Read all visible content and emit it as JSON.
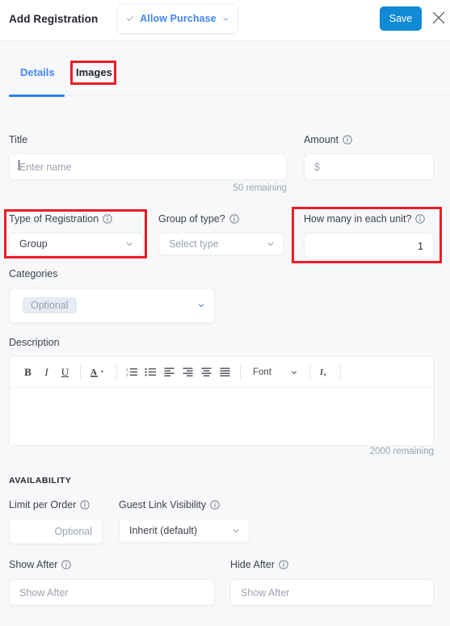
{
  "header": {
    "title": "Add Registration",
    "allow_purchase_label": "Allow Purchase",
    "save_label": "Save"
  },
  "tabs": [
    {
      "label": "Details",
      "active": true
    },
    {
      "label": "Images",
      "active": false
    }
  ],
  "form": {
    "title": {
      "label": "Title",
      "value": "",
      "placeholder": "Enter name",
      "counter": "50 remaining"
    },
    "amount": {
      "label": "Amount",
      "value": "",
      "placeholder": "$"
    },
    "type_of_registration": {
      "label": "Type of Registration",
      "value": "Group"
    },
    "group_of_type": {
      "label": "Group of type?",
      "value": "Select type"
    },
    "how_many_in_each_unit": {
      "label": "How many in each unit?",
      "value": "1"
    },
    "categories": {
      "label": "Categories",
      "chip": "Optional"
    },
    "description": {
      "label": "Description",
      "value": "",
      "counter": "2000 remaining",
      "toolbar": {
        "bold": "B",
        "italic": "I",
        "underline": "U",
        "text_color": "A",
        "font_label": "Font"
      }
    }
  },
  "availability": {
    "heading": "AVAILABILITY",
    "limit_per_order": {
      "label": "Limit per Order",
      "value": "",
      "placeholder": "Optional"
    },
    "guest_link_visibility": {
      "label": "Guest Link Visibility",
      "value": "Inherit (default)"
    },
    "show_after": {
      "label": "Show After",
      "value": "",
      "placeholder": "Show After"
    },
    "hide_after": {
      "label": "Hide After",
      "value": "",
      "placeholder": "Show After"
    }
  },
  "colors": {
    "accent_blue": "#4285f4",
    "save_blue": "#108ad5",
    "annotation_red": "#ee1c25",
    "background": "#f7f8fa",
    "placeholder": "#9aa3b0"
  }
}
